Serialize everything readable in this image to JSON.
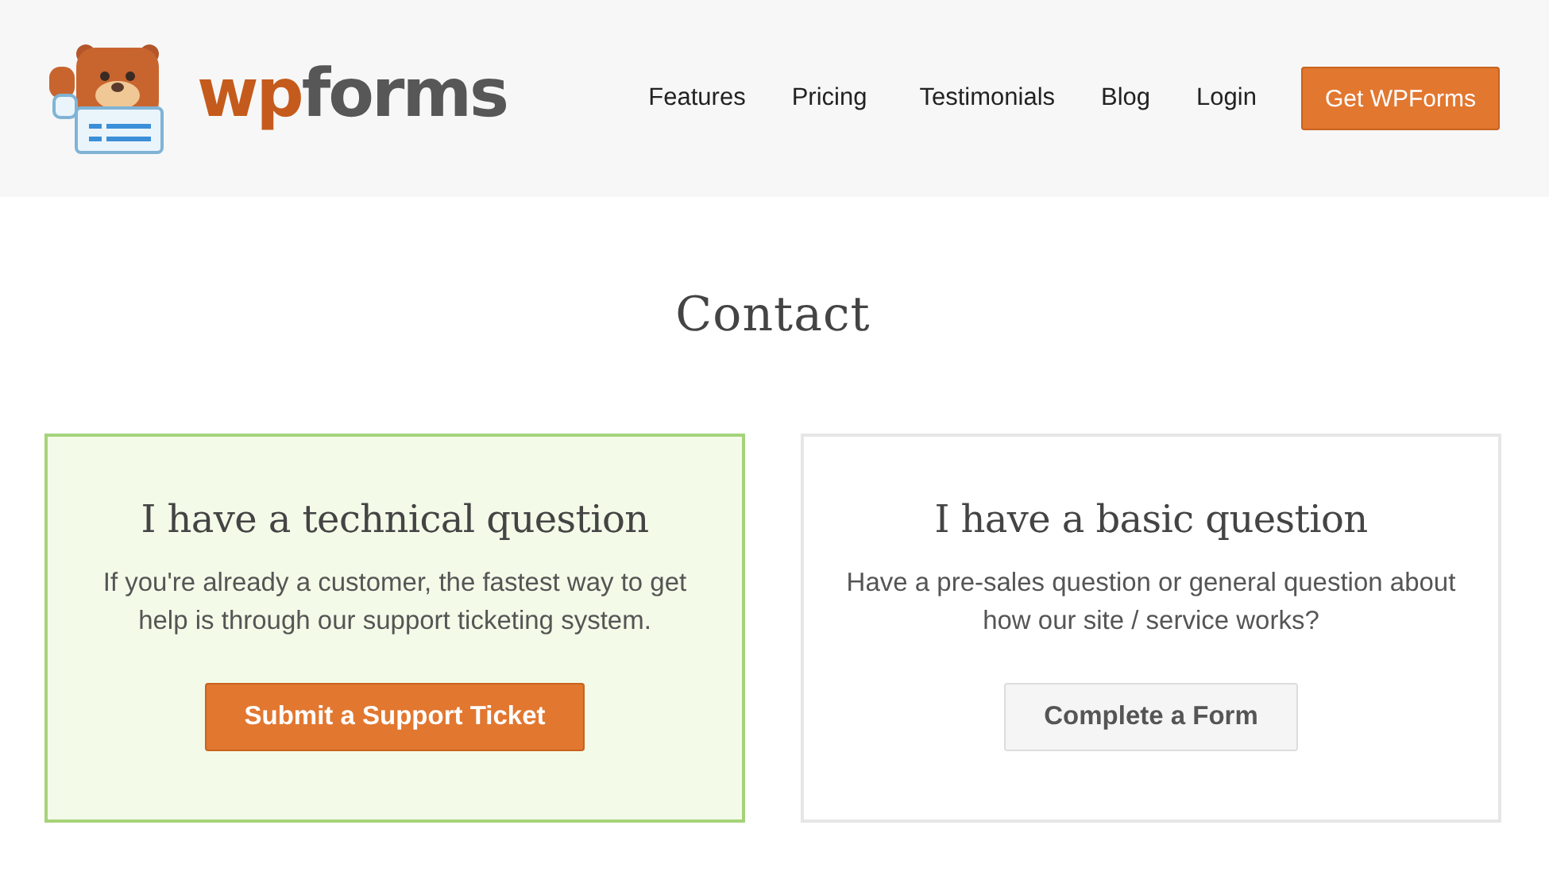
{
  "header": {
    "logo": {
      "accent": "wp",
      "rest": "forms"
    },
    "nav": [
      {
        "label": "Features"
      },
      {
        "label": "Pricing"
      },
      {
        "label": "Testimonials"
      },
      {
        "label": "Blog"
      },
      {
        "label": "Login"
      }
    ],
    "cta": "Get WPForms"
  },
  "page_title": "Contact",
  "cards": [
    {
      "title": "I have a technical question",
      "text": "If you're already a customer, the fastest way to get help is through our support ticketing system.",
      "highlighted": true,
      "button": {
        "label": "Submit a Support Ticket",
        "kind": "primary"
      }
    },
    {
      "title": "I have a basic question",
      "text": "Have a pre-sales question or general question about how our site / service works?",
      "highlighted": false,
      "button": {
        "label": "Complete a Form",
        "kind": "secondary"
      }
    }
  ]
}
